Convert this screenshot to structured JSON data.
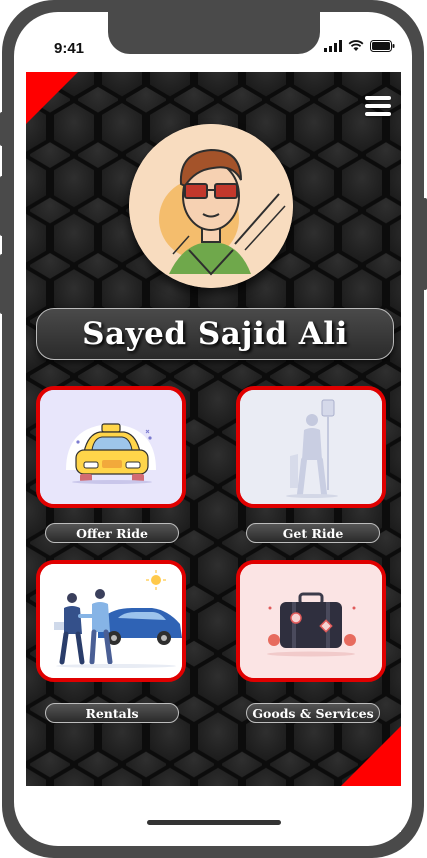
{
  "status_bar": {
    "time": "9:41"
  },
  "profile": {
    "name": "Sayed Sajid Ali"
  },
  "cards": [
    {
      "label": "Offer Ride"
    },
    {
      "label": "Get Ride"
    },
    {
      "label": "Rentals"
    },
    {
      "label": "Goods & Services"
    }
  ],
  "colors": {
    "accent": "#e00000",
    "background": "#1e1e1e"
  },
  "icons": {
    "menu": "hamburger-icon"
  }
}
